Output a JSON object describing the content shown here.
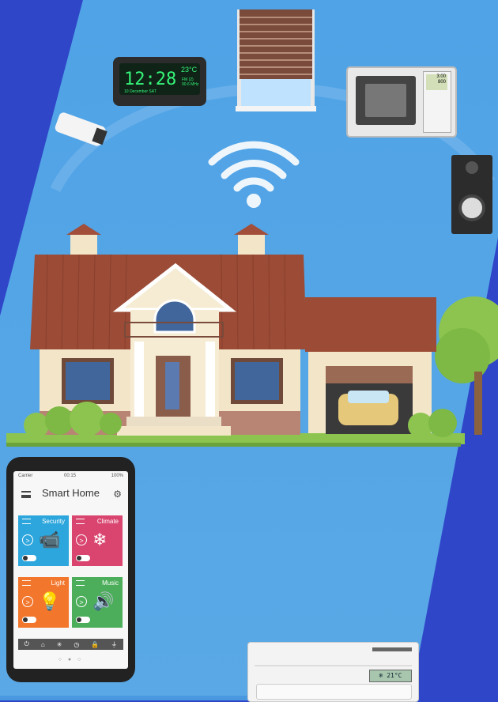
{
  "colors": {
    "background_blue": "#2f46c9",
    "sky": "#4a98df",
    "roof": "#9b4b36",
    "wall": "#f3e6c8",
    "lawn": "#8cc44f",
    "tile_security": "#2ca6dc",
    "tile_climate": "#d9456f",
    "tile_light": "#f2762c",
    "tile_music": "#4cae5a"
  },
  "phone": {
    "carrier": "Carrier",
    "time": "00:15",
    "battery": "100%",
    "title": "Smart Home",
    "tiles": [
      {
        "label": "Security",
        "icon": "security-camera-icon",
        "glyph": "📹"
      },
      {
        "label": "Climate",
        "icon": "air-conditioner-icon",
        "glyph": "❄"
      },
      {
        "label": "Light",
        "icon": "light-bulb-icon",
        "glyph": "💡"
      },
      {
        "label": "Music",
        "icon": "speaker-icon",
        "glyph": "🔊"
      }
    ],
    "bottom_icons": [
      "power-icon",
      "home-icon",
      "light-icon",
      "timer-icon",
      "lock-icon",
      "plug-icon"
    ],
    "bottom_glyphs": [
      "⏻",
      "⌂",
      "✳",
      "◷",
      "🔒",
      "⏚"
    ],
    "pagination": "○ ● ○"
  },
  "clock": {
    "time": "12:28",
    "temperature": "23°C",
    "date": "10 December  SAT",
    "radio": "FM (2)",
    "frequency": "90.6 MHz"
  },
  "microwave": {
    "display_line1": "3:00",
    "display_line2": "800"
  },
  "air_conditioner": {
    "display": "21°C"
  }
}
